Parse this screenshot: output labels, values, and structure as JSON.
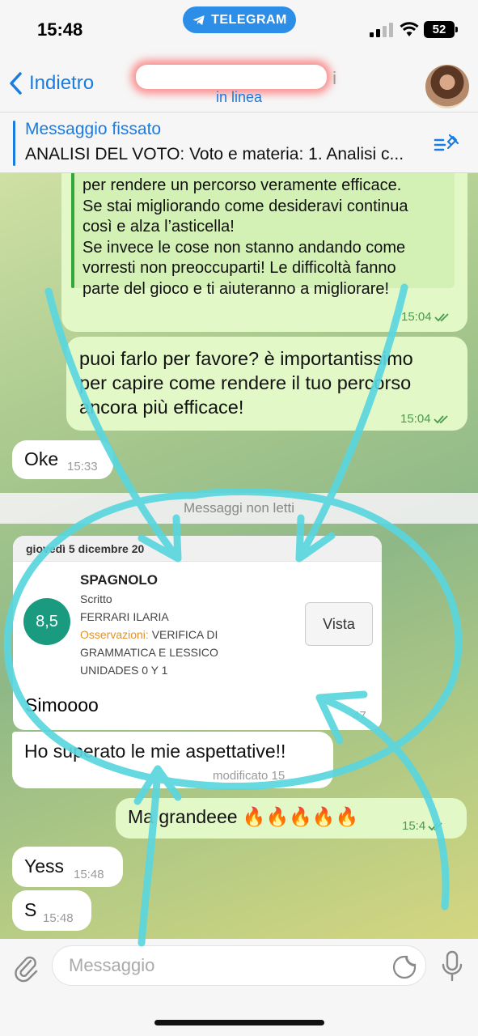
{
  "status_bar": {
    "time": "15:48",
    "app_pill": "TELEGRAM",
    "battery": "52"
  },
  "nav": {
    "back_label": "Indietro",
    "contact_name_tail": "i",
    "status": "in linea"
  },
  "pinned": {
    "title": "Messaggio fissato",
    "text": "ANALISI DEL VOTO: Voto e materia: 1. Analisi c..."
  },
  "messages": {
    "m1": {
      "lines": [
        "per rendere un percorso veramente efficace.",
        "Se stai migliorando come desideravi continua",
        "così e alza l’asticella!",
        "Se invece le cose non stanno andando come",
        "vorresti non preoccuparti! Le difficoltà fanno",
        "parte del gioco e ti aiuteranno a migliorare!"
      ],
      "time": "15:04"
    },
    "m2": {
      "lines": [
        "puoi farlo per favore? è importantissimo",
        "per capire come rendere il tuo percorso",
        "ancora più efficace!"
      ],
      "time": "15:04"
    },
    "m3": {
      "text": "Oke",
      "time": "15:33"
    },
    "separator": "Messaggi non letti",
    "card": {
      "date": "giovedì 5 dicembre 20",
      "grade": "8,5",
      "subject": "SPAGNOLO",
      "type": "Scritto",
      "teacher": "FERRARI ILARIA",
      "obs_label": "Osservazioni:",
      "obs_text_1": "VERIFICA DI",
      "obs_text_2": "GRAMMATICA E LESSICO",
      "obs_text_3": "UNIDADES 0 Y 1",
      "button": "Vista",
      "message": "Simoooo",
      "time": "47"
    },
    "m5": {
      "text": "Ho superato le mie aspettative!!",
      "meta": "modificato 15"
    },
    "m6": {
      "text": "Ma grandeee 🔥🔥🔥🔥🔥",
      "time": "15:4"
    },
    "m7": {
      "text": "Yess",
      "time": "15:48"
    },
    "m8": {
      "text": "S",
      "time": "15:48"
    }
  },
  "input": {
    "placeholder": "Messaggio"
  },
  "colors": {
    "accent": "#1a7ce0",
    "outgoing_bubble": "#e2f8c6",
    "grade_badge": "#1a9a7f",
    "marker": "#5ad6de"
  }
}
